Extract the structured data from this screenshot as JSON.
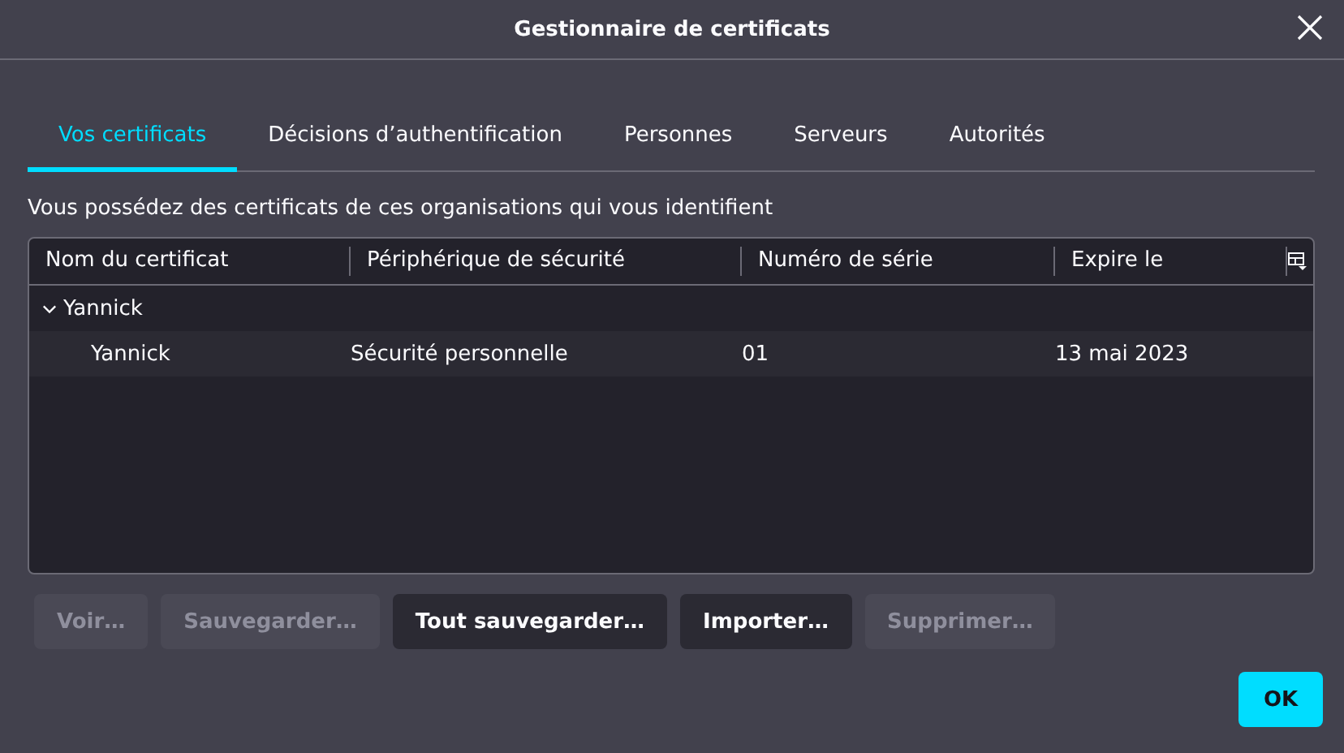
{
  "window": {
    "title": "Gestionnaire de certificats"
  },
  "tabs": [
    {
      "label": "Vos certificats",
      "selected": true
    },
    {
      "label": "Décisions d’authentification",
      "selected": false
    },
    {
      "label": "Personnes",
      "selected": false
    },
    {
      "label": "Serveurs",
      "selected": false
    },
    {
      "label": "Autorités",
      "selected": false
    }
  ],
  "description": "Vous possédez des certificats de ces organisations qui vous identifient",
  "table": {
    "columns": [
      "Nom du certificat",
      "Périphérique de sécurité",
      "Numéro de série",
      "Expire le"
    ],
    "rows": [
      {
        "label": "Yannick",
        "expanded": true,
        "children": [
          {
            "cells": [
              "Yannick",
              "Sécurité personnelle",
              "01",
              "13 mai 2023"
            ],
            "selected": true
          }
        ]
      }
    ]
  },
  "buttons": [
    {
      "label": "Voir…",
      "disabled": true
    },
    {
      "label": "Sauvegarder…",
      "disabled": true
    },
    {
      "label": "Tout sauvegarder…",
      "disabled": false
    },
    {
      "label": "Importer…",
      "disabled": false
    },
    {
      "label": "Supprimer…",
      "disabled": true
    }
  ],
  "ok_button": "OK"
}
